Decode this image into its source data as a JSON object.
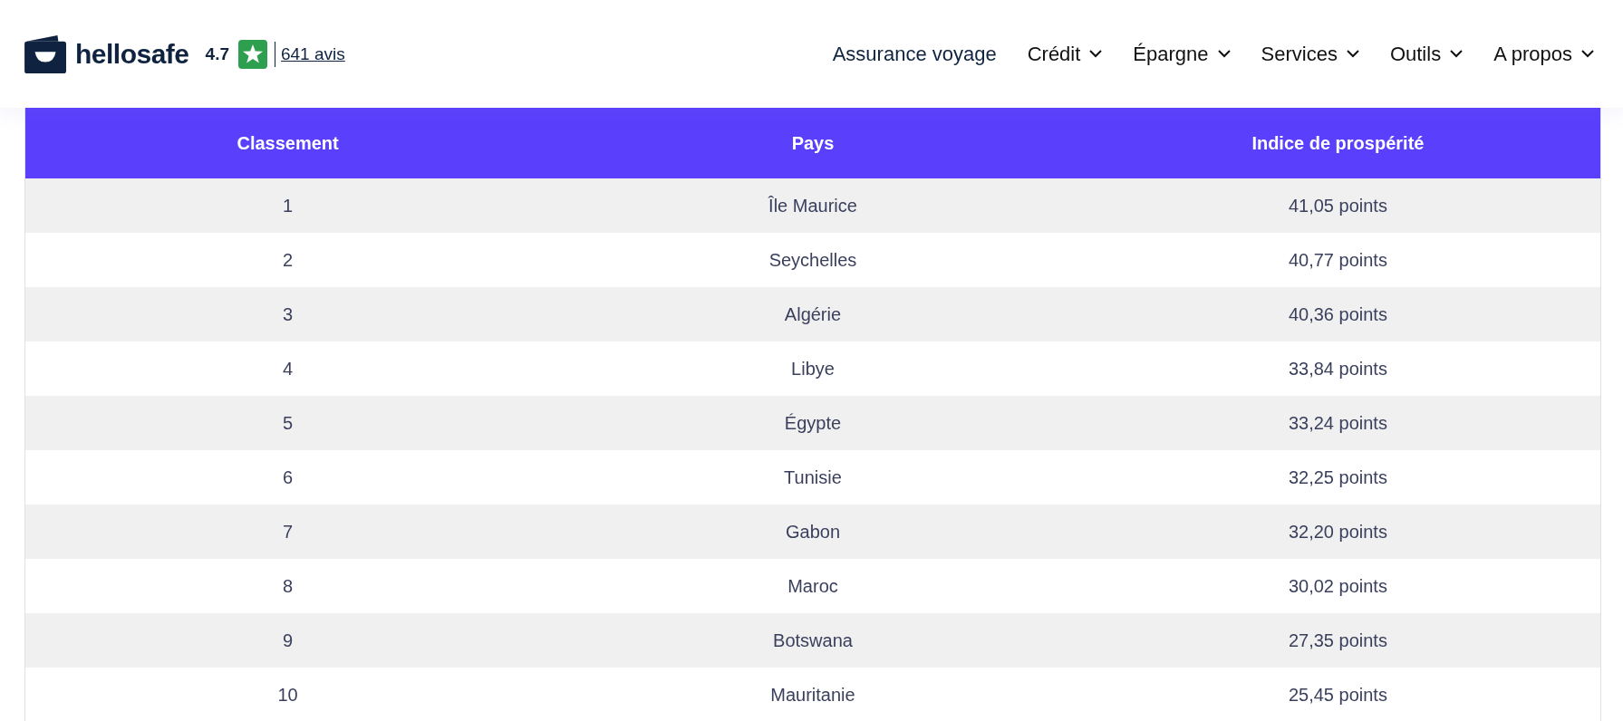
{
  "header": {
    "brand": "hellosafe",
    "rating": "4.7",
    "reviews": "641 avis",
    "nav": [
      {
        "label": "Assurance voyage",
        "has_caret": false
      },
      {
        "label": "Crédit",
        "has_caret": true
      },
      {
        "label": "Épargne",
        "has_caret": true
      },
      {
        "label": "Services",
        "has_caret": true
      },
      {
        "label": "Outils",
        "has_caret": true
      },
      {
        "label": "A propos",
        "has_caret": true
      }
    ]
  },
  "table": {
    "columns": [
      "Classement",
      "Pays",
      "Indice de prospérité"
    ],
    "rows": [
      [
        "1",
        "Île Maurice",
        "41,05 points"
      ],
      [
        "2",
        "Seychelles",
        "40,77 points"
      ],
      [
        "3",
        "Algérie",
        "40,36 points"
      ],
      [
        "4",
        "Libye",
        "33,84 points"
      ],
      [
        "5",
        "Égypte",
        "33,24 points"
      ],
      [
        "6",
        "Tunisie",
        "32,25 points"
      ],
      [
        "7",
        "Gabon",
        "32,20 points"
      ],
      [
        "8",
        "Maroc",
        "30,02 points"
      ],
      [
        "9",
        "Botswana",
        "27,35 points"
      ],
      [
        "10",
        "Mauritanie",
        "25,45 points"
      ]
    ]
  }
}
